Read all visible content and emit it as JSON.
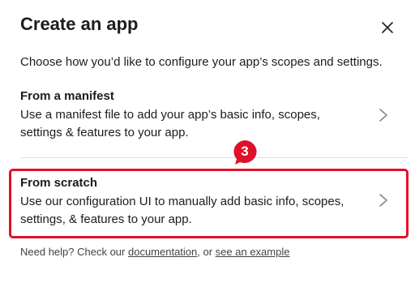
{
  "dialog": {
    "title": "Create an app",
    "subtitle": "Choose how you’d like to configure your app’s scopes and settings.",
    "close_icon": "close-icon"
  },
  "options": [
    {
      "title": "From a manifest",
      "description": "Use a manifest file to add your app’s basic info, scopes, settings & features to your app.",
      "icon": "chevron-right-icon"
    },
    {
      "title": "From scratch",
      "description": "Use our configuration UI to manually add basic info, scopes, settings, & features to your app.",
      "icon": "chevron-right-icon"
    }
  ],
  "annotation": {
    "step_number": "3",
    "color": "#e0102a"
  },
  "footer": {
    "prefix": "Need help? Check our ",
    "doc_link": "documentation",
    "middle": ", or ",
    "example_link": "see an example"
  }
}
